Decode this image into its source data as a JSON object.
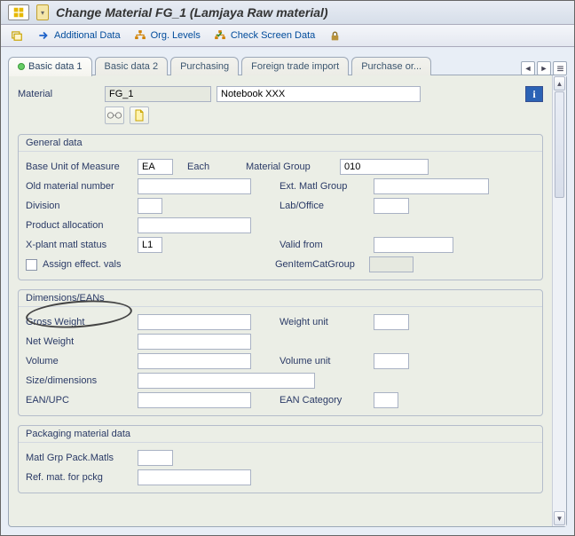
{
  "titlebar": {
    "title": "Change Material FG_1 (Lamjaya Raw material)"
  },
  "toolbar": {
    "additional": "Additional Data",
    "orglevels": "Org. Levels",
    "check": "Check Screen Data"
  },
  "tabs": {
    "t0": "Basic data 1",
    "t1": "Basic data 2",
    "t2": "Purchasing",
    "t3": "Foreign trade import",
    "t4": "Purchase or..."
  },
  "header": {
    "material_label": "Material",
    "material": "FG_1",
    "description": "Notebook XXX"
  },
  "general": {
    "title": "General data",
    "buom_label": "Base Unit of Measure",
    "buom": "EA",
    "buom_text": "Each",
    "matgroup_label": "Material Group",
    "matgroup": "010",
    "oldmat_label": "Old material number",
    "oldmat": "",
    "extmat_label": "Ext. Matl Group",
    "extmat": "",
    "division_label": "Division",
    "division": "",
    "lab_label": "Lab/Office",
    "lab": "",
    "prodalloc_label": "Product allocation",
    "prodalloc": "",
    "xplant_label": "X-plant matl status",
    "xplant": "L1",
    "validfrom_label": "Valid from",
    "validfrom": "",
    "assign_label": "Assign effect. vals",
    "genitem_label": "GenItemCatGroup",
    "genitem": ""
  },
  "dimensions": {
    "title": "Dimensions/EANs",
    "gross_label": "Gross Weight",
    "gross": "",
    "wunit_label": "Weight unit",
    "wunit": "",
    "net_label": "Net Weight",
    "net": "",
    "vol_label": "Volume",
    "vol": "",
    "vunit_label": "Volume unit",
    "vunit": "",
    "size_label": "Size/dimensions",
    "size": "",
    "ean_label": "EAN/UPC",
    "ean": "",
    "eancat_label": "EAN Category",
    "eancat": ""
  },
  "packaging": {
    "title": "Packaging material data",
    "matlgrp_label": "Matl Grp Pack.Matls",
    "matlgrp": "",
    "refmat_label": "Ref. mat. for pckg",
    "refmat": ""
  }
}
